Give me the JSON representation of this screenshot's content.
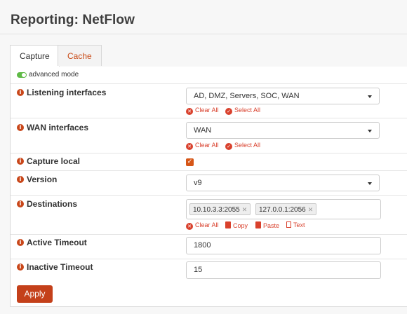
{
  "page": {
    "title": "Reporting: NetFlow"
  },
  "tabs": [
    {
      "label": "Capture"
    },
    {
      "label": "Cache"
    }
  ],
  "advanced_mode": {
    "label": "advanced mode",
    "enabled": true
  },
  "fields": {
    "listening_interfaces": {
      "label": "Listening interfaces",
      "value": "AD, DMZ, Servers, SOC, WAN",
      "clear_all": "Clear All",
      "select_all": "Select All"
    },
    "wan_interfaces": {
      "label": "WAN interfaces",
      "value": "WAN",
      "clear_all": "Clear All",
      "select_all": "Select All"
    },
    "capture_local": {
      "label": "Capture local",
      "checked": true
    },
    "version": {
      "label": "Version",
      "value": "v9"
    },
    "destinations": {
      "label": "Destinations",
      "tokens": [
        "10.10.3.3:2055",
        "127.0.0.1:2056"
      ],
      "actions": {
        "clear_all": "Clear All",
        "copy": "Copy",
        "paste": "Paste",
        "text": "Text"
      }
    },
    "active_timeout": {
      "label": "Active Timeout",
      "value": "1800"
    },
    "inactive_timeout": {
      "label": "Inactive Timeout",
      "value": "15"
    }
  },
  "buttons": {
    "apply": "Apply"
  },
  "colors": {
    "accent": "#c4401a",
    "link": "#d9412d",
    "toggle_on": "#5fba46"
  }
}
